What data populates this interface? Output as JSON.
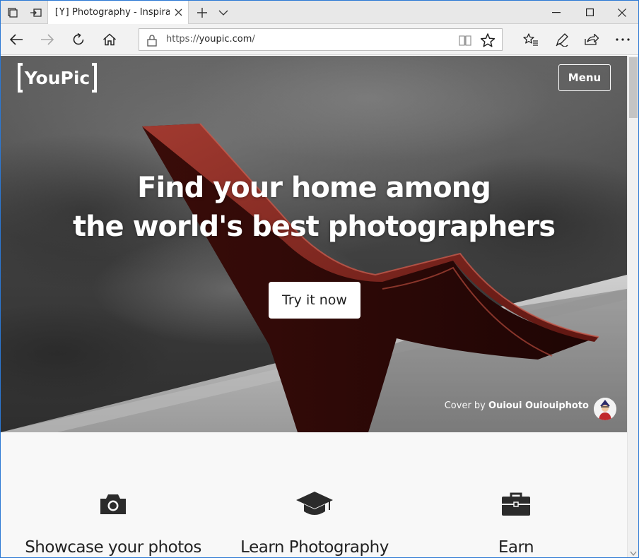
{
  "browser": {
    "tab_title": "Photography - Inspiratio",
    "tab_favicon": "[Y]",
    "url_scheme": "https://",
    "url_host": "youpic.com",
    "url_path": "/"
  },
  "header": {
    "logo_text": "YouPic",
    "menu_label": "Menu"
  },
  "hero": {
    "headline_line1": "Find your home among",
    "headline_line2": "the world's best photographers",
    "cta_label": "Try it now",
    "credit_prefix": "Cover by ",
    "credit_author": "Ouioui Ouiouiphoto"
  },
  "features": [
    {
      "icon": "camera-icon",
      "label": "Showcase your photos"
    },
    {
      "icon": "graduation-cap-icon",
      "label": "Learn Photography"
    },
    {
      "icon": "briefcase-icon",
      "label": "Earn"
    }
  ],
  "colors": {
    "window_border": "#2b78d4",
    "accent_red": "#8b2a22",
    "text_dark": "#222222"
  }
}
